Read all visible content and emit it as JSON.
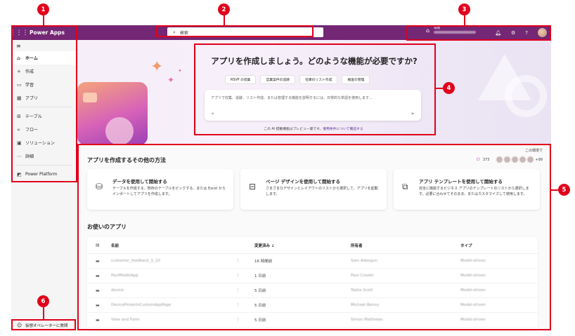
{
  "topbar": {
    "app_name": "Power Apps",
    "search_placeholder": "検索",
    "environment_label": "環境"
  },
  "sidebar": {
    "items": [
      {
        "label": "ホーム",
        "icon": "home-icon"
      },
      {
        "label": "作成",
        "icon": "plus-icon"
      },
      {
        "label": "学習",
        "icon": "book-icon"
      },
      {
        "label": "アプリ",
        "icon": "apps-icon"
      },
      {
        "label": "テーブル",
        "icon": "table-icon"
      },
      {
        "label": "フロー",
        "icon": "flow-icon"
      },
      {
        "label": "ソリューション",
        "icon": "solution-icon"
      },
      {
        "label": "詳細",
        "icon": "more-icon"
      },
      {
        "label": "Power Platform",
        "icon": "power-platform-icon"
      }
    ],
    "bottom_label": "仮想オペレーターに質問"
  },
  "hero": {
    "title": "アプリを作成しましょう。どのような機能が必要ですか?",
    "chips": [
      "RSVP の収集",
      "営業案件の追跡",
      "在庫のリスト作成",
      "検査の管理"
    ],
    "prompt_placeholder": "アプリで収集、追跡、リスト作成、または管理する機能を説明するには、日常的な単語を使用します...",
    "disclaimer_text": "この AI 搭載機能はプレビュー版です。",
    "disclaimer_link": "使用条件について確認する"
  },
  "other_ways": {
    "title": "アプリを作成するその他の方法",
    "env_note": "この環境で",
    "people_count": "373",
    "more": "+99",
    "cards": [
      {
        "title": "データを使用して開始する",
        "desc": "テーブルを作成する、既存のテーブルをピックする、または Excel からインポートしてアプリを作成します。",
        "icon": "database-icon"
      },
      {
        "title": "ページ デザインを使用して開始する",
        "desc": "さまざまなデザインとレイアウトのリストから選択して、アプリを起動します。",
        "icon": "page-design-icon"
      },
      {
        "title": "アプリ テンプレートを使用して開始する",
        "desc": "完全に機能するビジネス アプリのテンプレートのリストから選択します。必要に合わせてそのまま、またはカスタマイズして使用します。",
        "icon": "template-icon"
      }
    ]
  },
  "your_apps": {
    "title": "お使いのアプリ",
    "columns": [
      "名前",
      "変更済み ↓",
      "所有者",
      "タイプ"
    ],
    "rows": [
      {
        "name": "customer_feedback_5_10",
        "modified": "16 時間前",
        "owner": "Sam Adesgun",
        "type": "Model-driven"
      },
      {
        "name": "PaulModelApp",
        "modified": "1 日前",
        "owner": "Paul Crozier",
        "type": "Model-driven"
      },
      {
        "name": "device",
        "modified": "5 日前",
        "owner": "Tasha Scott",
        "type": "Model-driven"
      },
      {
        "name": "DevicePickerInCustomAppPage",
        "modified": "5 日前",
        "owner": "Michael Benoy",
        "type": "Model-driven"
      },
      {
        "name": "View and Form",
        "modified": "5 日前",
        "owner": "Simon Matthews",
        "type": "Model-driven"
      }
    ]
  },
  "annotations": [
    "1",
    "2",
    "3",
    "4",
    "5",
    "6"
  ],
  "colors": {
    "accent": "#742774",
    "annotation": "#e0001b"
  }
}
